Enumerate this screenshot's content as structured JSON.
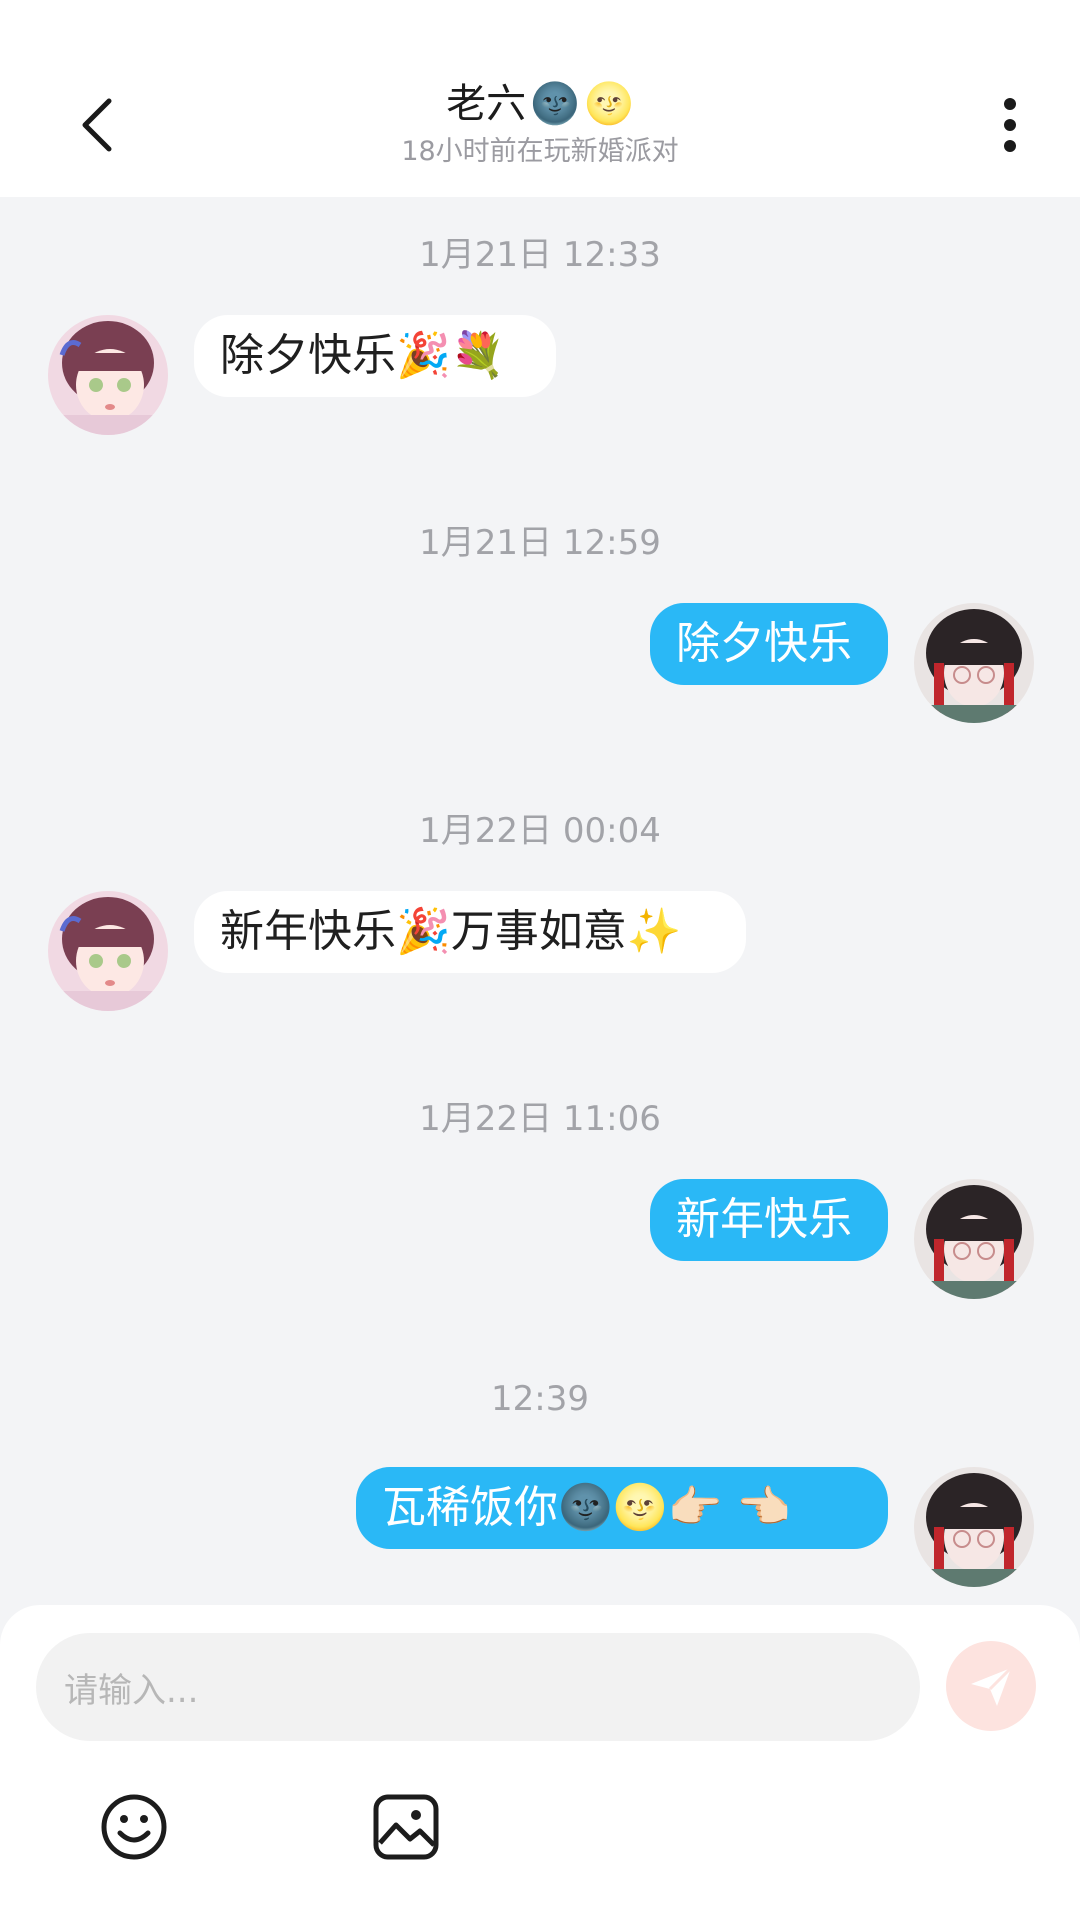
{
  "header": {
    "title": "老六",
    "title_emojis": [
      "🌚",
      "🌝"
    ],
    "subtitle": "18小时前在玩新婚派对"
  },
  "messages": [
    {
      "time": "1月21日 12:33",
      "side": "in",
      "text": "除夕快乐🎉💐"
    },
    {
      "time": "1月21日 12:59",
      "side": "out",
      "text": "除夕快乐"
    },
    {
      "time": "1月22日 00:04",
      "side": "in",
      "text": "新年快乐🎉万事如意✨"
    },
    {
      "time": "1月22日 11:06",
      "side": "out",
      "text": "新年快乐"
    },
    {
      "time": "12:39",
      "side": "out",
      "text": "瓦稀饭你🌚🌝👉🏻 👈🏻"
    }
  ],
  "input": {
    "placeholder": "请输入..."
  },
  "icons": {
    "back": "chevron-left-icon",
    "menu": "more-vertical-icon",
    "send": "send-icon",
    "emoji": "emoji-icon",
    "image": "image-icon"
  },
  "colors": {
    "outgoing_bubble": "#2ab8f6",
    "incoming_bubble": "#ffffff",
    "background": "#f3f4f6",
    "send_button": "#fde3df"
  }
}
